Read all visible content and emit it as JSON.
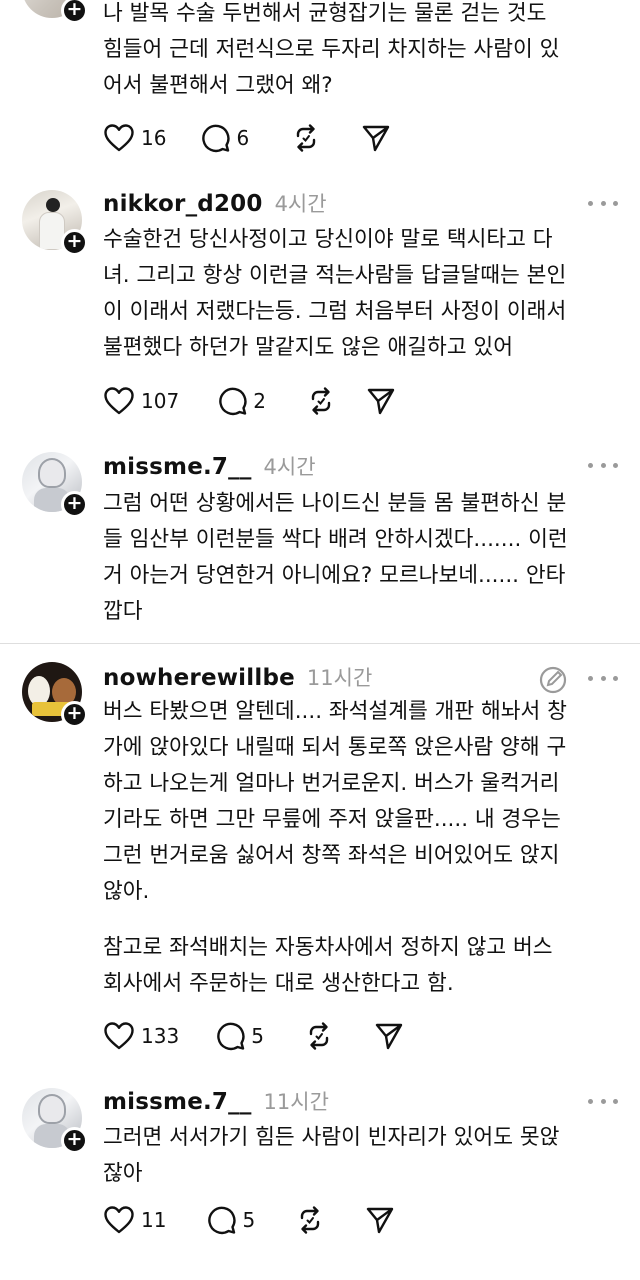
{
  "threads": [
    {
      "username": "",
      "time": "",
      "text": "나 발목 수술 두번해서 균형잡기는 물론 걷는 것도\n힘들어 근데 저런식으로 두자리 차지하는 사람이 있\n어서 불편해서 그랬어 왜?",
      "likes": "16",
      "replies": "6"
    },
    {
      "username": "nikkor_d200",
      "time": "4시간",
      "text": "수술한건 당신사정이고 당신이야 말로 택시타고 다\n녀. 그리고 항상 이런글 적는사람들 답글달때는 본인\n이 이래서 저랬다는등. 그럼 처음부터 사정이 이래서\n불편했다 하던가 말같지도 않은 애길하고 있어",
      "likes": "107",
      "replies": "2"
    },
    {
      "username": "missme.7__",
      "time": "4시간",
      "text": "그럼 어떤 상황에서든 나이드신 분들 몸 불편하신 분\n들 임산부 이런분들 싹다 배려 안하시겠다....... 이런\n거 아는거 당연한거 아니에요? 모르나보네...... 안타\n깝다"
    },
    {
      "username": "nowherewillbe",
      "time": "11시간",
      "text": "버스 타봤으면 알텐데.... 좌석설계를 개판 해놔서 창\n가에 앉아있다 내릴때 되서 통로쪽 앉은사람 양해 구\n하고 나오는게 얼마나 번거로운지. 버스가 울컥거리\n기라도 하면 그만 무릎에 주저 앉을판..... 내 경우는\n그런 번거로움 싫어서 창쪽 좌석은 비어있어도 앉지\n않아.",
      "text2": "참고로 좌석배치는 자동차사에서 정하지 않고 버스\n회사에서 주문하는 대로 생산한다고 함.",
      "likes": "133",
      "replies": "5"
    },
    {
      "username": "missme.7__",
      "time": "11시간",
      "text": "그러면 서서가기 힘든 사람이 빈자리가 있어도 못앉\n잖아",
      "likes": "11",
      "replies": "5"
    }
  ],
  "icons": {
    "like": "heart-icon",
    "reply": "comment-bubble-icon",
    "repost": "repost-icon",
    "share": "send-icon",
    "more": "more-dots-icon",
    "follow": "plus-icon"
  }
}
